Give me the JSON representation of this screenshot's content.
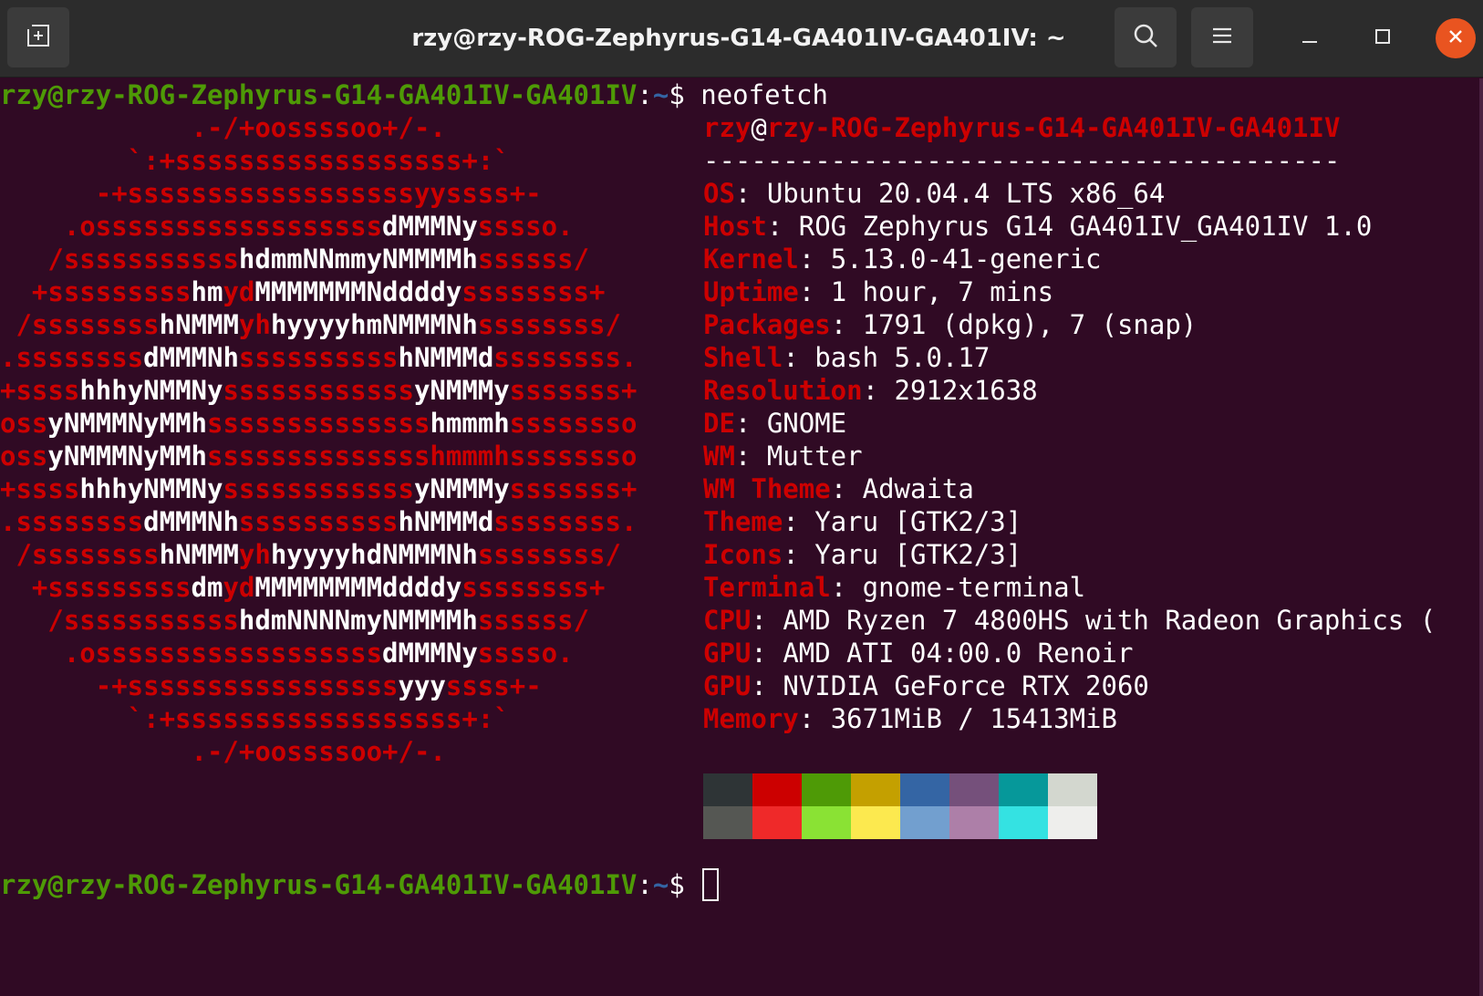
{
  "window": {
    "title": "rzy@rzy-ROG-Zephyrus-G14-GA401IV-GA401IV: ~",
    "icons": [
      "new-tab-icon",
      "search-icon",
      "hamburger-menu-icon",
      "minimize-icon",
      "maximize-icon",
      "close-icon"
    ]
  },
  "colors": {
    "background": "#300a24",
    "prompt_user": "#4e9a06",
    "prompt_path": "#3465a4",
    "logo": "#cc0000",
    "close": "#e95420"
  },
  "prompt1": {
    "user": "rzy@rzy-ROG-Zephyrus-G14-GA401IV-GA401IV",
    "colon": ":",
    "path": "~",
    "symbol": "$ ",
    "command": "neofetch"
  },
  "prompt2": {
    "user": "rzy@rzy-ROG-Zephyrus-G14-GA401IV-GA401IV",
    "colon": ":",
    "path": "~",
    "symbol": "$ "
  },
  "logo": [
    [
      [
        "r",
        "            .-/+oossssoo+/-."
      ]
    ],
    [
      [
        "r",
        "        `:+ssssssssssssssssss+:`"
      ]
    ],
    [
      [
        "r",
        "      -+ssssssssssssssssssyyssss+-"
      ]
    ],
    [
      [
        "r",
        "    .ossssssssssssssssss"
      ],
      [
        "w",
        "dMMMNy"
      ],
      [
        "r",
        "sssso."
      ]
    ],
    [
      [
        "r",
        "   /sssssssssss"
      ],
      [
        "w",
        "hdmmNNmmyNMMMMh"
      ],
      [
        "r",
        "ssssss/"
      ]
    ],
    [
      [
        "r",
        "  +sssssssss"
      ],
      [
        "w",
        "hm"
      ],
      [
        "r",
        "yd"
      ],
      [
        "w",
        "MMMMMMMNddddy"
      ],
      [
        "r",
        "ssssssss+"
      ]
    ],
    [
      [
        "r",
        " /ssssssss"
      ],
      [
        "w",
        "hNMMM"
      ],
      [
        "r",
        "yh"
      ],
      [
        "w",
        "hyyyyhmNMMMNh"
      ],
      [
        "r",
        "ssssssss/"
      ]
    ],
    [
      [
        "r",
        ".ssssssss"
      ],
      [
        "w",
        "dMMMNh"
      ],
      [
        "r",
        "ssssssssss"
      ],
      [
        "w",
        "hNMMMd"
      ],
      [
        "r",
        "ssssssss."
      ]
    ],
    [
      [
        "r",
        "+ssss"
      ],
      [
        "w",
        "hhhyNMMNy"
      ],
      [
        "r",
        "ssssssssssss"
      ],
      [
        "w",
        "yNMMMy"
      ],
      [
        "r",
        "sssssss+"
      ]
    ],
    [
      [
        "r",
        "oss"
      ],
      [
        "w",
        "yNMMMNyMMh"
      ],
      [
        "r",
        "ssssssssssssss"
      ],
      [
        "w",
        "hmmmh"
      ],
      [
        "r",
        "ssssssso"
      ]
    ],
    [
      [
        "r",
        "oss"
      ],
      [
        "w",
        "yNMMMNyMMh"
      ],
      [
        "r",
        "sssssssssssssshmmmhssssssso"
      ]
    ],
    [
      [
        "r",
        "+ssss"
      ],
      [
        "w",
        "hhhyNMMNy"
      ],
      [
        "r",
        "ssssssssssss"
      ],
      [
        "w",
        "yNMMMy"
      ],
      [
        "r",
        "sssssss+"
      ]
    ],
    [
      [
        "r",
        ".ssssssss"
      ],
      [
        "w",
        "dMMMNh"
      ],
      [
        "r",
        "ssssssssss"
      ],
      [
        "w",
        "hNMMMd"
      ],
      [
        "r",
        "ssssssss."
      ]
    ],
    [
      [
        "r",
        " /ssssssss"
      ],
      [
        "w",
        "hNMMM"
      ],
      [
        "r",
        "yh"
      ],
      [
        "w",
        "hyyyyhdNMMMNh"
      ],
      [
        "r",
        "ssssssss/"
      ]
    ],
    [
      [
        "r",
        "  +sssssssss"
      ],
      [
        "w",
        "dm"
      ],
      [
        "r",
        "yd"
      ],
      [
        "w",
        "MMMMMMMMddddy"
      ],
      [
        "r",
        "ssssssss+"
      ]
    ],
    [
      [
        "r",
        "   /sssssssssss"
      ],
      [
        "w",
        "hdmNNNNmyNMMMMh"
      ],
      [
        "r",
        "ssssss/"
      ]
    ],
    [
      [
        "r",
        "    .ossssssssssssssssss"
      ],
      [
        "w",
        "dMMMNy"
      ],
      [
        "r",
        "sssso."
      ]
    ],
    [
      [
        "r",
        "      -+sssssssssssssssss"
      ],
      [
        "w",
        "yyy"
      ],
      [
        "r",
        "ssss+-"
      ]
    ],
    [
      [
        "r",
        "        `:+ssssssssssssssssss+:`"
      ]
    ],
    [
      [
        "r",
        "            .-/+oossssoo+/-."
      ]
    ]
  ],
  "info_header": {
    "user": "rzy",
    "at": "@",
    "host": "rzy-ROG-Zephyrus-G14-GA401IV-GA401IV",
    "separator": "----------------------------------------"
  },
  "info": [
    {
      "key": "OS",
      "value": "Ubuntu 20.04.4 LTS x86_64"
    },
    {
      "key": "Host",
      "value": "ROG Zephyrus G14 GA401IV_GA401IV 1.0"
    },
    {
      "key": "Kernel",
      "value": "5.13.0-41-generic"
    },
    {
      "key": "Uptime",
      "value": "1 hour, 7 mins"
    },
    {
      "key": "Packages",
      "value": "1791 (dpkg), 7 (snap)"
    },
    {
      "key": "Shell",
      "value": "bash 5.0.17"
    },
    {
      "key": "Resolution",
      "value": "2912x1638"
    },
    {
      "key": "DE",
      "value": "GNOME"
    },
    {
      "key": "WM",
      "value": "Mutter"
    },
    {
      "key": "WM Theme",
      "value": "Adwaita"
    },
    {
      "key": "Theme",
      "value": "Yaru [GTK2/3]"
    },
    {
      "key": "Icons",
      "value": "Yaru [GTK2/3]"
    },
    {
      "key": "Terminal",
      "value": "gnome-terminal"
    },
    {
      "key": "CPU",
      "value": "AMD Ryzen 7 4800HS with Radeon Graphics ("
    },
    {
      "key": "GPU",
      "value": "AMD ATI 04:00.0 Renoir"
    },
    {
      "key": "GPU",
      "value": "NVIDIA GeForce RTX 2060"
    },
    {
      "key": "Memory",
      "value": "3671MiB / 15413MiB"
    }
  ],
  "palette": [
    [
      "#2e3436",
      "#cc0000",
      "#4e9a06",
      "#c4a000",
      "#3465a4",
      "#75507b",
      "#06989a",
      "#d3d7cf"
    ],
    [
      "#555753",
      "#ef2929",
      "#8ae234",
      "#fce94f",
      "#729fcf",
      "#ad7fa8",
      "#34e2e2",
      "#eeeeec"
    ]
  ]
}
